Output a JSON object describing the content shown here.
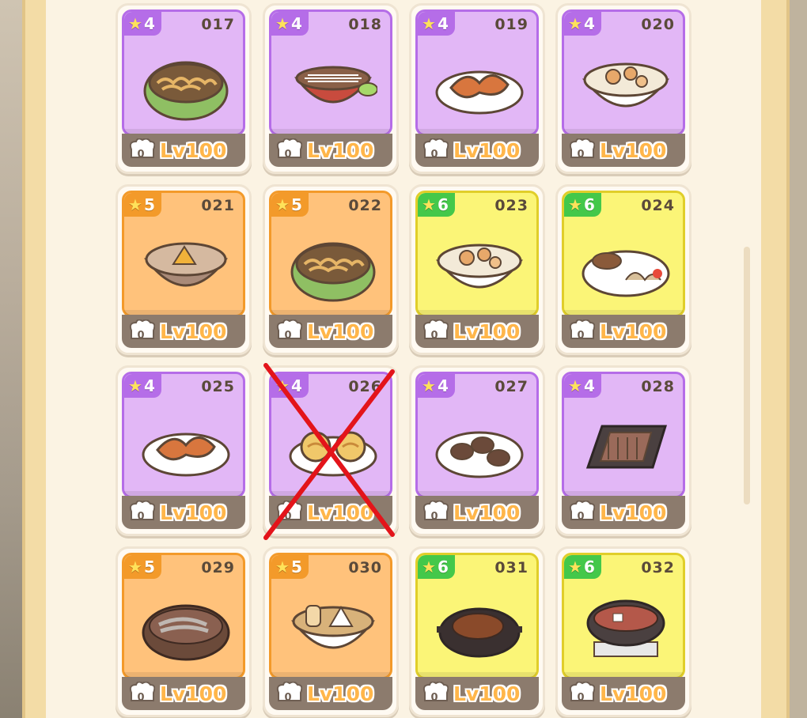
{
  "colors": {
    "purple": "#b56de8",
    "orange": "#f39a2a",
    "green": "#44c84a",
    "level": "#ffb64a",
    "cross": "#e3141a"
  },
  "cards": [
    {
      "number": "017",
      "stars": "4",
      "rarity": "p",
      "level": "Lv100",
      "hat_count": "0",
      "dish": "bowl-green"
    },
    {
      "number": "018",
      "stars": "4",
      "rarity": "p",
      "level": "Lv100",
      "hat_count": "0",
      "dish": "bowl-red"
    },
    {
      "number": "019",
      "stars": "4",
      "rarity": "p",
      "level": "Lv100",
      "hat_count": "0",
      "dish": "plate-sausage"
    },
    {
      "number": "020",
      "stars": "4",
      "rarity": "p",
      "level": "Lv100",
      "hat_count": "0",
      "dish": "bowl-white"
    },
    {
      "number": "021",
      "stars": "5",
      "rarity": "o",
      "level": "Lv100",
      "hat_count": "0",
      "dish": "bowl-brown"
    },
    {
      "number": "022",
      "stars": "5",
      "rarity": "o",
      "level": "Lv100",
      "hat_count": "0",
      "dish": "bowl-green"
    },
    {
      "number": "023",
      "stars": "6",
      "rarity": "y",
      "level": "Lv100",
      "hat_count": "0",
      "dish": "bowl-white"
    },
    {
      "number": "024",
      "stars": "6",
      "rarity": "y",
      "level": "Lv100",
      "hat_count": "0",
      "dish": "plate-set"
    },
    {
      "number": "025",
      "stars": "4",
      "rarity": "p",
      "level": "Lv100",
      "hat_count": "0",
      "dish": "plate-sausage"
    },
    {
      "number": "026",
      "stars": "4",
      "rarity": "p",
      "level": "Lv100",
      "hat_count": "0",
      "dish": "plate-rolls"
    },
    {
      "number": "027",
      "stars": "4",
      "rarity": "p",
      "level": "Lv100",
      "hat_count": "0",
      "dish": "plate-patty"
    },
    {
      "number": "028",
      "stars": "4",
      "rarity": "p",
      "level": "Lv100",
      "hat_count": "0",
      "dish": "board-meat"
    },
    {
      "number": "029",
      "stars": "5",
      "rarity": "o",
      "level": "Lv100",
      "hat_count": "0",
      "dish": "pot-fish"
    },
    {
      "number": "030",
      "stars": "5",
      "rarity": "o",
      "level": "Lv100",
      "hat_count": "0",
      "dish": "bowl-oden"
    },
    {
      "number": "031",
      "stars": "6",
      "rarity": "y",
      "level": "Lv100",
      "hat_count": "0",
      "dish": "pan-steak"
    },
    {
      "number": "032",
      "stars": "6",
      "rarity": "y",
      "level": "Lv100",
      "hat_count": "0",
      "dish": "pot-hot"
    }
  ],
  "crossed_out_card": "026"
}
